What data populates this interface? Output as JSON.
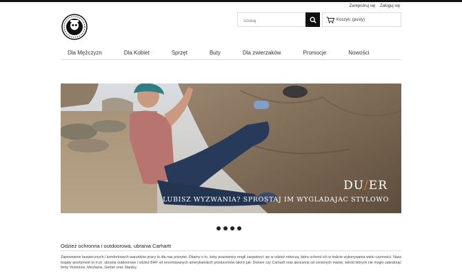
{
  "header": {
    "register_label": "Zarejestruj się",
    "login_label": "Zaloguj się",
    "search_placeholder": "Szukaj",
    "cart_label": "Koszyk:",
    "cart_status": "(pusty)"
  },
  "nav": {
    "items": [
      {
        "label": "Dla Mężczyzn"
      },
      {
        "label": "Dla Kobiet"
      },
      {
        "label": "Sprzęt"
      },
      {
        "label": "Buty"
      },
      {
        "label": "Dla zwierzaków"
      },
      {
        "label": "Promocje"
      },
      {
        "label": "Nowości"
      }
    ]
  },
  "banner": {
    "brand_part1": "DU",
    "brand_slash": "/",
    "brand_part2": "ER",
    "tagline": "LUBISZ WYZWANIA? SPROSTAJ IM WYGLADAJAC STYLOWO"
  },
  "slider": {
    "dot_count": 4
  },
  "about": {
    "title": "Odzież ochronna i outdoorowa, ubrania Carhartt",
    "text": "Zapewnienie bezpiecznych i komfortowych warunków pracy to dla nas priorytet. Dbamy o to, żeby pracownicy mogli zaopatrzyć się w odzież roboczą, która ochroni ich w trakcie wykonywania wielu czynności. Nasz bogaty asortyment to m.in. ubrania outdoorowe i odzież BHP od renomowanych amerykańskich producentów takich jak: Dickies czy Carhartt oraz akcesoria od cenionych marek, wśród których nie mogło zabraknąć firmy Victorinox, Mechanix, Gerber oraz Stanley."
  }
}
